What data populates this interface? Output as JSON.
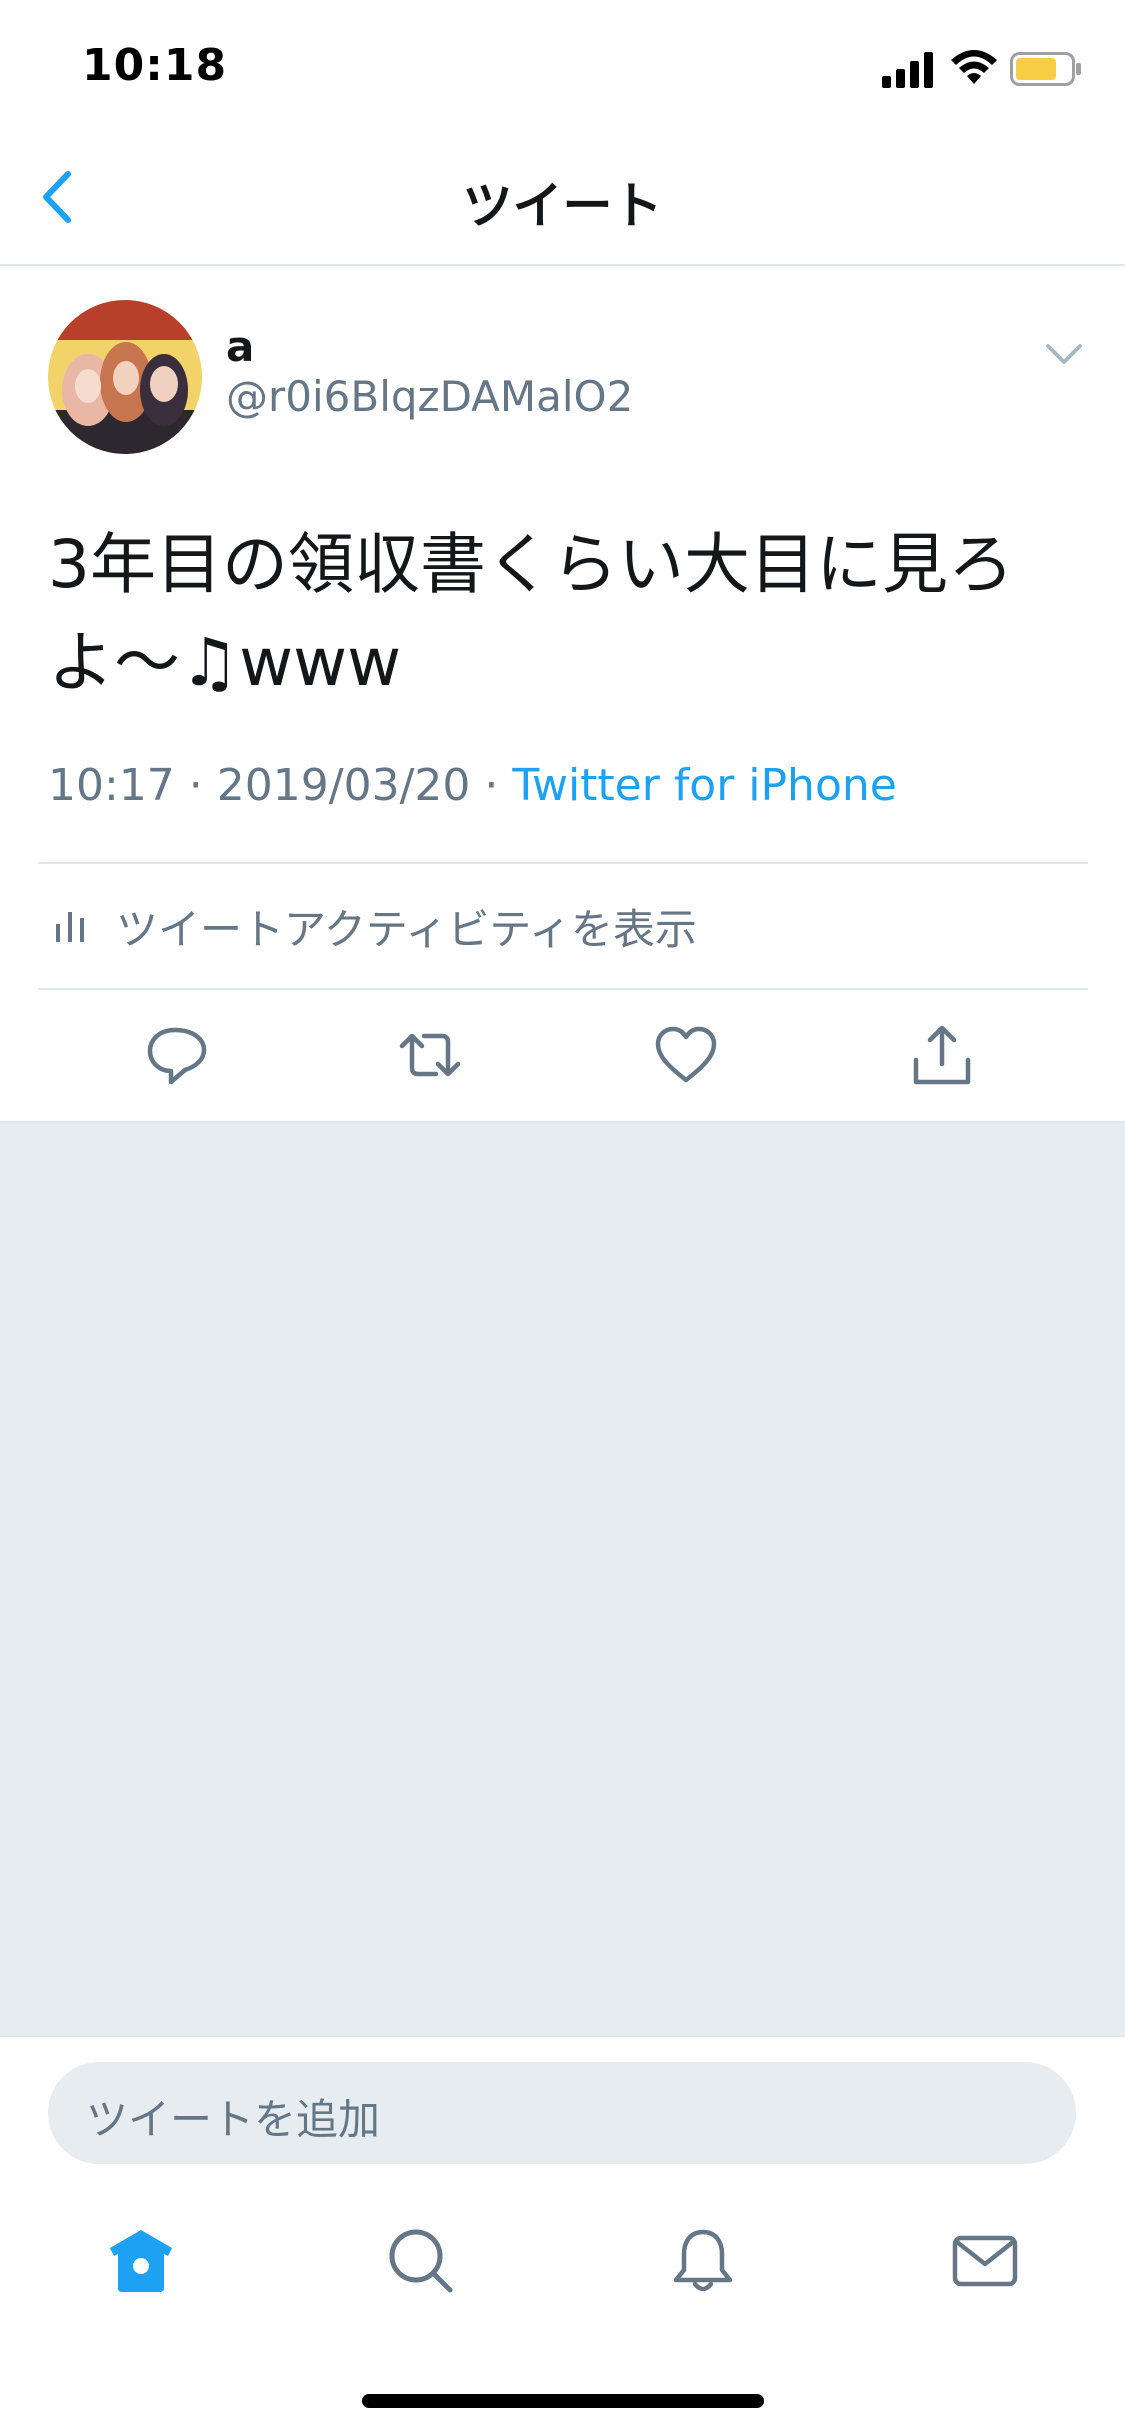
{
  "status_bar": {
    "time": "10:18"
  },
  "nav": {
    "title": "ツイート"
  },
  "tweet": {
    "author": {
      "display_name": "a",
      "handle": "@r0i6BlqzDAMalO2"
    },
    "text_line1": "3年目の領収書くらい大目に見ろ",
    "text_line2": "よ～♫www",
    "meta": {
      "time": "10:17",
      "sep1": " · ",
      "date": "2019/03/20",
      "sep2": " · ",
      "source": "Twitter for iPhone"
    },
    "activity_label": "ツイートアクティビティを表示"
  },
  "composer": {
    "placeholder": "ツイートを追加"
  },
  "icons": [
    "back-chevron-icon",
    "chevron-down-icon",
    "reply-icon",
    "retweet-icon",
    "like-icon",
    "share-icon",
    "activity-icon",
    "home-icon",
    "search-icon",
    "notifications-icon",
    "messages-icon"
  ],
  "colors": {
    "accent": "#1da1f2",
    "muted": "#657786",
    "gray_bg": "#e6ecf0",
    "battery": "#f6cd45"
  }
}
